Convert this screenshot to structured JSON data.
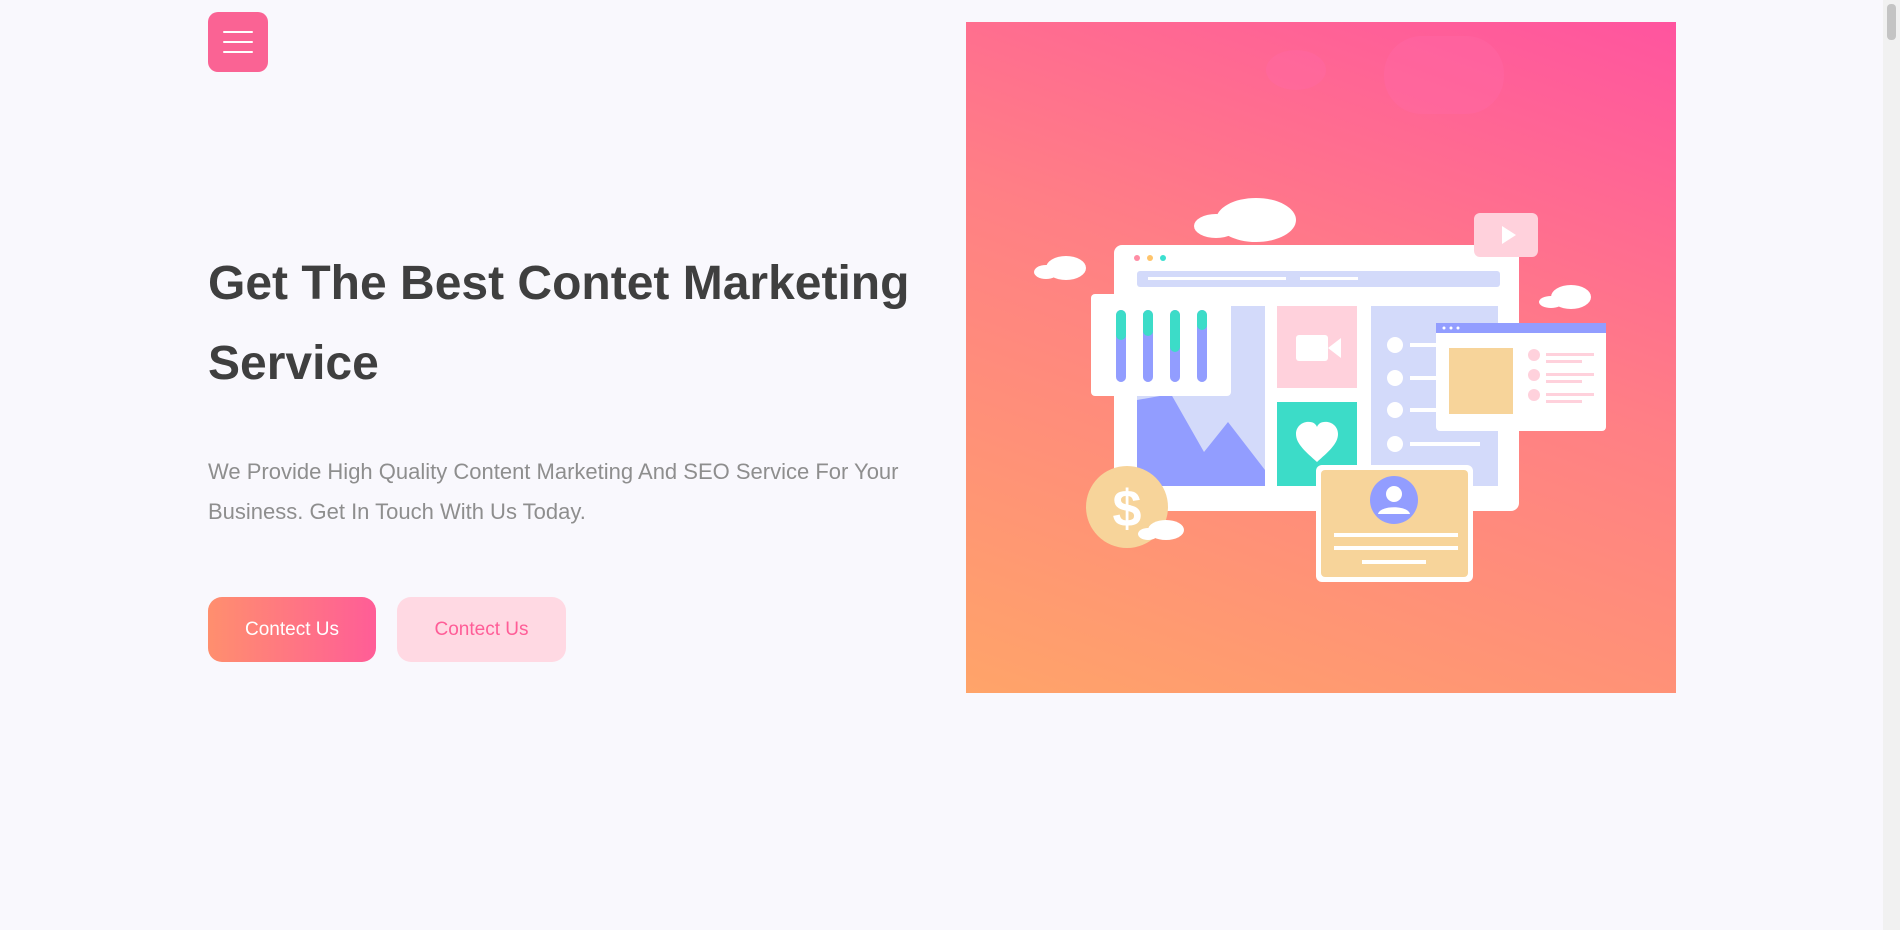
{
  "hero": {
    "title": "Get The Best Contet Marketing Service",
    "description": "We Provide High Quality Content Marketing And SEO Service For Your Business. Get In Touch With Us Today.",
    "primary_button": "Contect Us",
    "secondary_button": "Contect Us"
  },
  "icons": {
    "menu": "hamburger-menu-icon"
  },
  "colors": {
    "accent": "#fa6394",
    "title": "#3f3f3f",
    "text": "#8e8e8e",
    "background": "#f9f8fd"
  }
}
